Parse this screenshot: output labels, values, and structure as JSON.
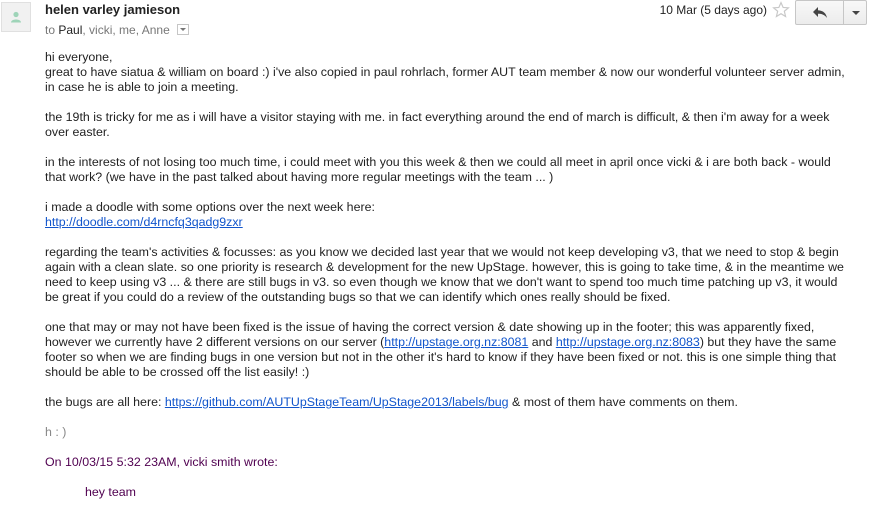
{
  "message": {
    "sender": "helen varley jamieson",
    "to_prefix": "to",
    "to_primary": "Paul",
    "to_rest": ", vicki, me, Anne",
    "date": "10 Mar (5 days ago)",
    "icons": [
      "contact-avatar-icon",
      "star-icon",
      "reply-icon",
      "more-options-icon",
      "recipients-dropdown-icon"
    ],
    "colors": {
      "link": "#1155cc",
      "quoted": "#500050",
      "signature": "#888888"
    }
  },
  "body": {
    "greeting": "hi everyone,",
    "p1": "great to have siatua & william on board :) i've also copied in paul rohrlach, former AUT team member & now our wonderful volunteer server admin, in case he is able to join a meeting.",
    "p2": "the 19th is tricky for me as i will have a visitor staying with me. in fact everything around the end of march is difficult, & then i'm away for a week over easter.",
    "p3": "in the interests of not losing too much time, i could meet with you this week & then we could all meet in april once vicki & i are both back - would that work? (we have in the past talked about having more regular meetings with the team ... )",
    "p4_text": "i made a doodle with some options over the next week here:",
    "p4_link": "http://doodle.com/d4rncfq3qadg9zxr",
    "p5": "regarding the team's activities & focusses: as you know we decided last year that we would not keep developing v3, that we need to stop & begin again with a clean slate. so one priority is research & development for the new UpStage. however, this is going to take time, & in the meantime we need to keep using v3 ... & there are still bugs in v3. so even though we know that we don't want to spend too much time patching up v3, it would be great if you could do a review of the outstanding bugs so that we can identify which ones really should be fixed.",
    "p6_a": "one that may or may not have been fixed is the issue of having the correct version & date showing up in the footer; this was apparently fixed, however we currently have 2 different versions on our server (",
    "p6_link1": "http://upstage.org.nz:8081",
    "p6_b": " and ",
    "p6_link2": "http://upstage.org.nz:8083",
    "p6_c": ") but they have the same footer so when we are finding bugs in one version but not in the other it's hard to know if they have been fixed or not. this is one simple thing that should be able to be crossed off the list easily! :)",
    "p7_a": "the bugs are all here: ",
    "p7_link": "https://github.com/AUTUpStageTeam/UpStage2013/labels/bug",
    "p7_b": " & most of them have comments on them.",
    "signature": "h : )",
    "quote_header": "On 10/03/15 5:32 23AM, vicki smith wrote:",
    "quoted_text": "hey team"
  }
}
